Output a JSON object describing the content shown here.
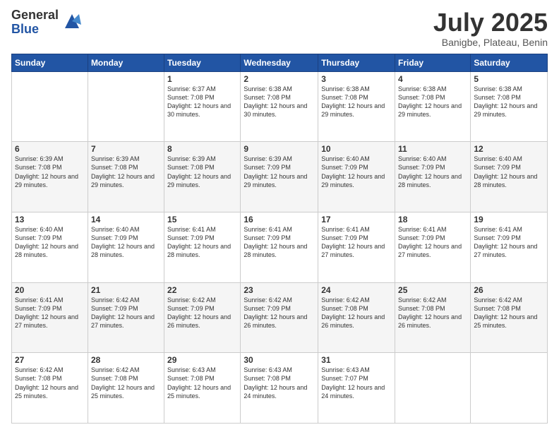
{
  "header": {
    "logo_general": "General",
    "logo_blue": "Blue",
    "month_title": "July 2025",
    "subtitle": "Banigbe, Plateau, Benin"
  },
  "weekdays": [
    "Sunday",
    "Monday",
    "Tuesday",
    "Wednesday",
    "Thursday",
    "Friday",
    "Saturday"
  ],
  "weeks": [
    [
      {
        "day": "",
        "info": ""
      },
      {
        "day": "",
        "info": ""
      },
      {
        "day": "1",
        "info": "Sunrise: 6:37 AM\nSunset: 7:08 PM\nDaylight: 12 hours and 30 minutes."
      },
      {
        "day": "2",
        "info": "Sunrise: 6:38 AM\nSunset: 7:08 PM\nDaylight: 12 hours and 30 minutes."
      },
      {
        "day": "3",
        "info": "Sunrise: 6:38 AM\nSunset: 7:08 PM\nDaylight: 12 hours and 29 minutes."
      },
      {
        "day": "4",
        "info": "Sunrise: 6:38 AM\nSunset: 7:08 PM\nDaylight: 12 hours and 29 minutes."
      },
      {
        "day": "5",
        "info": "Sunrise: 6:38 AM\nSunset: 7:08 PM\nDaylight: 12 hours and 29 minutes."
      }
    ],
    [
      {
        "day": "6",
        "info": "Sunrise: 6:39 AM\nSunset: 7:08 PM\nDaylight: 12 hours and 29 minutes."
      },
      {
        "day": "7",
        "info": "Sunrise: 6:39 AM\nSunset: 7:08 PM\nDaylight: 12 hours and 29 minutes."
      },
      {
        "day": "8",
        "info": "Sunrise: 6:39 AM\nSunset: 7:08 PM\nDaylight: 12 hours and 29 minutes."
      },
      {
        "day": "9",
        "info": "Sunrise: 6:39 AM\nSunset: 7:09 PM\nDaylight: 12 hours and 29 minutes."
      },
      {
        "day": "10",
        "info": "Sunrise: 6:40 AM\nSunset: 7:09 PM\nDaylight: 12 hours and 29 minutes."
      },
      {
        "day": "11",
        "info": "Sunrise: 6:40 AM\nSunset: 7:09 PM\nDaylight: 12 hours and 28 minutes."
      },
      {
        "day": "12",
        "info": "Sunrise: 6:40 AM\nSunset: 7:09 PM\nDaylight: 12 hours and 28 minutes."
      }
    ],
    [
      {
        "day": "13",
        "info": "Sunrise: 6:40 AM\nSunset: 7:09 PM\nDaylight: 12 hours and 28 minutes."
      },
      {
        "day": "14",
        "info": "Sunrise: 6:40 AM\nSunset: 7:09 PM\nDaylight: 12 hours and 28 minutes."
      },
      {
        "day": "15",
        "info": "Sunrise: 6:41 AM\nSunset: 7:09 PM\nDaylight: 12 hours and 28 minutes."
      },
      {
        "day": "16",
        "info": "Sunrise: 6:41 AM\nSunset: 7:09 PM\nDaylight: 12 hours and 28 minutes."
      },
      {
        "day": "17",
        "info": "Sunrise: 6:41 AM\nSunset: 7:09 PM\nDaylight: 12 hours and 27 minutes."
      },
      {
        "day": "18",
        "info": "Sunrise: 6:41 AM\nSunset: 7:09 PM\nDaylight: 12 hours and 27 minutes."
      },
      {
        "day": "19",
        "info": "Sunrise: 6:41 AM\nSunset: 7:09 PM\nDaylight: 12 hours and 27 minutes."
      }
    ],
    [
      {
        "day": "20",
        "info": "Sunrise: 6:41 AM\nSunset: 7:09 PM\nDaylight: 12 hours and 27 minutes."
      },
      {
        "day": "21",
        "info": "Sunrise: 6:42 AM\nSunset: 7:09 PM\nDaylight: 12 hours and 27 minutes."
      },
      {
        "day": "22",
        "info": "Sunrise: 6:42 AM\nSunset: 7:09 PM\nDaylight: 12 hours and 26 minutes."
      },
      {
        "day": "23",
        "info": "Sunrise: 6:42 AM\nSunset: 7:09 PM\nDaylight: 12 hours and 26 minutes."
      },
      {
        "day": "24",
        "info": "Sunrise: 6:42 AM\nSunset: 7:08 PM\nDaylight: 12 hours and 26 minutes."
      },
      {
        "day": "25",
        "info": "Sunrise: 6:42 AM\nSunset: 7:08 PM\nDaylight: 12 hours and 26 minutes."
      },
      {
        "day": "26",
        "info": "Sunrise: 6:42 AM\nSunset: 7:08 PM\nDaylight: 12 hours and 25 minutes."
      }
    ],
    [
      {
        "day": "27",
        "info": "Sunrise: 6:42 AM\nSunset: 7:08 PM\nDaylight: 12 hours and 25 minutes."
      },
      {
        "day": "28",
        "info": "Sunrise: 6:42 AM\nSunset: 7:08 PM\nDaylight: 12 hours and 25 minutes."
      },
      {
        "day": "29",
        "info": "Sunrise: 6:43 AM\nSunset: 7:08 PM\nDaylight: 12 hours and 25 minutes."
      },
      {
        "day": "30",
        "info": "Sunrise: 6:43 AM\nSunset: 7:08 PM\nDaylight: 12 hours and 24 minutes."
      },
      {
        "day": "31",
        "info": "Sunrise: 6:43 AM\nSunset: 7:07 PM\nDaylight: 12 hours and 24 minutes."
      },
      {
        "day": "",
        "info": ""
      },
      {
        "day": "",
        "info": ""
      }
    ]
  ]
}
